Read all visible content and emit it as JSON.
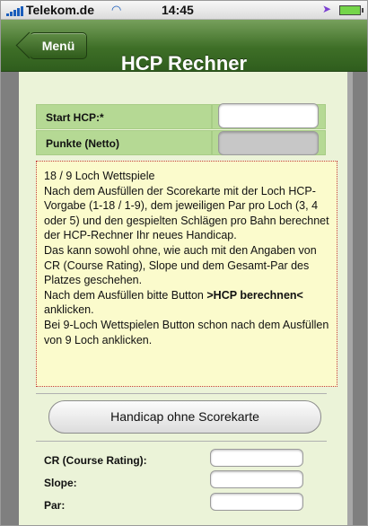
{
  "status_bar": {
    "carrier": "Telekom.de",
    "time": "14:45",
    "icons": [
      "signal-icon",
      "wifi-icon",
      "location-arrow-icon",
      "battery-icon"
    ]
  },
  "nav": {
    "back_label": "Menü",
    "title": "HCP Rechner"
  },
  "form": {
    "start_hcp_label": "Start HCP:*",
    "start_hcp_value": "",
    "punkte_label": "Punkte (Netto)",
    "punkte_value": ""
  },
  "info": {
    "heading": "18 / 9 Loch Wettspiele",
    "paragraph1": "Nach dem Ausfüllen der Scorekarte mit der Loch HCP-Vorgabe (1-18 / 1-9), dem jeweiligen Par pro Loch (3, 4 oder 5) und den gespielten Schlägen pro Bahn berechnet der HCP-Rechner Ihr neues Handicap.",
    "paragraph2": "Das kann sowohl ohne, wie auch mit den Angaben von CR (Course Rating), Slope und dem Gesamt-Par des Platzes geschehen.",
    "instruction_pre": "Nach dem Ausfüllen bitte Button ",
    "instruction_bold": ">HCP berechnen<",
    "instruction_post": " anklicken.",
    "paragraph3": "Bei 9-Loch Wettspielen Button schon nach dem Ausfüllen von 9 Loch anklicken."
  },
  "buttons": {
    "handicap_ohne": "Handicap ohne Scorekarte"
  },
  "course": {
    "cr_label": "CR (Course Rating):",
    "slope_label": "Slope:",
    "par_label": "Par:",
    "cr_value": "",
    "slope_value": "",
    "par_value": ""
  },
  "colors": {
    "nav_green": "#3e6f27",
    "label_cell_green": "#b5d994",
    "content_bg": "#ebf3d8",
    "info_bg": "#fbfbcc",
    "info_border": "#c23b3b"
  }
}
